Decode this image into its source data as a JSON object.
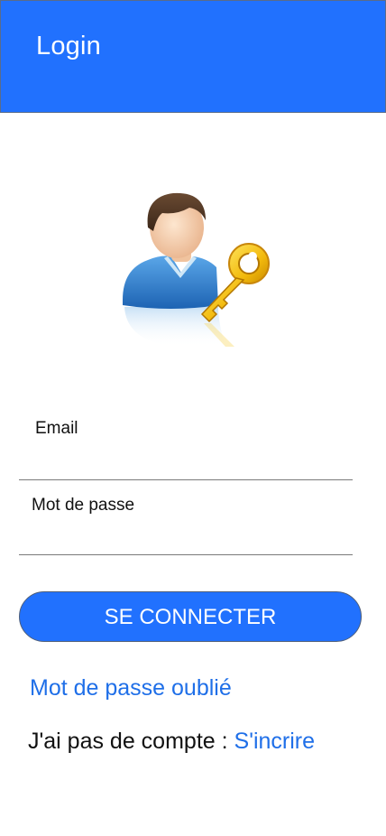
{
  "header": {
    "title": "Login"
  },
  "form": {
    "email_label": "Email",
    "email_value": "",
    "password_label": "Mot de passe",
    "password_value": "",
    "submit_label": "SE CONNECTER"
  },
  "links": {
    "forgot_password": "Mot de passe oublié",
    "no_account_text": "J'ai pas de compte : ",
    "signup": "S'incrire"
  },
  "icons": {
    "avatar": "user-key-icon"
  },
  "colors": {
    "primary": "#2171fe",
    "link": "#1f6fe8",
    "text": "#111111"
  }
}
